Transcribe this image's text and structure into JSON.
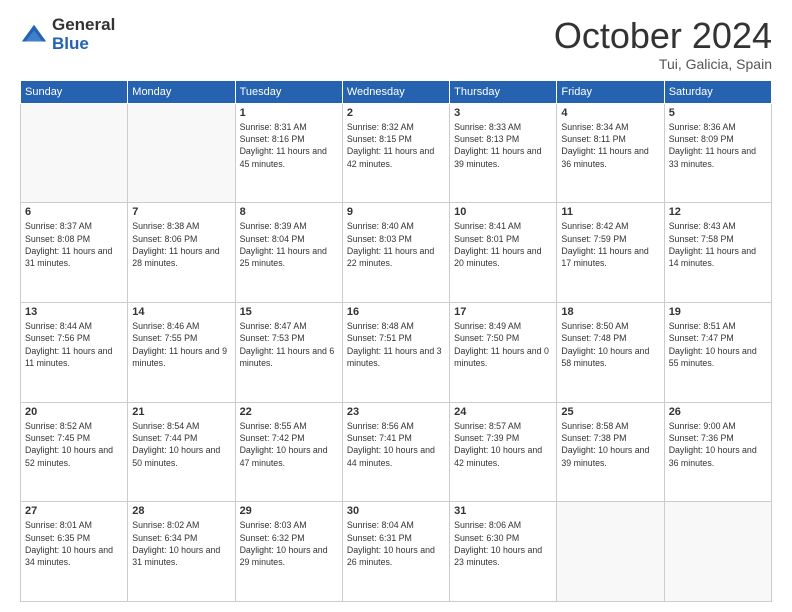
{
  "logo": {
    "general": "General",
    "blue": "Blue"
  },
  "header": {
    "month": "October 2024",
    "location": "Tui, Galicia, Spain"
  },
  "days_of_week": [
    "Sunday",
    "Monday",
    "Tuesday",
    "Wednesday",
    "Thursday",
    "Friday",
    "Saturday"
  ],
  "weeks": [
    [
      {
        "day": "",
        "sunrise": "",
        "sunset": "",
        "daylight": ""
      },
      {
        "day": "",
        "sunrise": "",
        "sunset": "",
        "daylight": ""
      },
      {
        "day": "1",
        "sunrise": "Sunrise: 8:31 AM",
        "sunset": "Sunset: 8:16 PM",
        "daylight": "Daylight: 11 hours and 45 minutes."
      },
      {
        "day": "2",
        "sunrise": "Sunrise: 8:32 AM",
        "sunset": "Sunset: 8:15 PM",
        "daylight": "Daylight: 11 hours and 42 minutes."
      },
      {
        "day": "3",
        "sunrise": "Sunrise: 8:33 AM",
        "sunset": "Sunset: 8:13 PM",
        "daylight": "Daylight: 11 hours and 39 minutes."
      },
      {
        "day": "4",
        "sunrise": "Sunrise: 8:34 AM",
        "sunset": "Sunset: 8:11 PM",
        "daylight": "Daylight: 11 hours and 36 minutes."
      },
      {
        "day": "5",
        "sunrise": "Sunrise: 8:36 AM",
        "sunset": "Sunset: 8:09 PM",
        "daylight": "Daylight: 11 hours and 33 minutes."
      }
    ],
    [
      {
        "day": "6",
        "sunrise": "Sunrise: 8:37 AM",
        "sunset": "Sunset: 8:08 PM",
        "daylight": "Daylight: 11 hours and 31 minutes."
      },
      {
        "day": "7",
        "sunrise": "Sunrise: 8:38 AM",
        "sunset": "Sunset: 8:06 PM",
        "daylight": "Daylight: 11 hours and 28 minutes."
      },
      {
        "day": "8",
        "sunrise": "Sunrise: 8:39 AM",
        "sunset": "Sunset: 8:04 PM",
        "daylight": "Daylight: 11 hours and 25 minutes."
      },
      {
        "day": "9",
        "sunrise": "Sunrise: 8:40 AM",
        "sunset": "Sunset: 8:03 PM",
        "daylight": "Daylight: 11 hours and 22 minutes."
      },
      {
        "day": "10",
        "sunrise": "Sunrise: 8:41 AM",
        "sunset": "Sunset: 8:01 PM",
        "daylight": "Daylight: 11 hours and 20 minutes."
      },
      {
        "day": "11",
        "sunrise": "Sunrise: 8:42 AM",
        "sunset": "Sunset: 7:59 PM",
        "daylight": "Daylight: 11 hours and 17 minutes."
      },
      {
        "day": "12",
        "sunrise": "Sunrise: 8:43 AM",
        "sunset": "Sunset: 7:58 PM",
        "daylight": "Daylight: 11 hours and 14 minutes."
      }
    ],
    [
      {
        "day": "13",
        "sunrise": "Sunrise: 8:44 AM",
        "sunset": "Sunset: 7:56 PM",
        "daylight": "Daylight: 11 hours and 11 minutes."
      },
      {
        "day": "14",
        "sunrise": "Sunrise: 8:46 AM",
        "sunset": "Sunset: 7:55 PM",
        "daylight": "Daylight: 11 hours and 9 minutes."
      },
      {
        "day": "15",
        "sunrise": "Sunrise: 8:47 AM",
        "sunset": "Sunset: 7:53 PM",
        "daylight": "Daylight: 11 hours and 6 minutes."
      },
      {
        "day": "16",
        "sunrise": "Sunrise: 8:48 AM",
        "sunset": "Sunset: 7:51 PM",
        "daylight": "Daylight: 11 hours and 3 minutes."
      },
      {
        "day": "17",
        "sunrise": "Sunrise: 8:49 AM",
        "sunset": "Sunset: 7:50 PM",
        "daylight": "Daylight: 11 hours and 0 minutes."
      },
      {
        "day": "18",
        "sunrise": "Sunrise: 8:50 AM",
        "sunset": "Sunset: 7:48 PM",
        "daylight": "Daylight: 10 hours and 58 minutes."
      },
      {
        "day": "19",
        "sunrise": "Sunrise: 8:51 AM",
        "sunset": "Sunset: 7:47 PM",
        "daylight": "Daylight: 10 hours and 55 minutes."
      }
    ],
    [
      {
        "day": "20",
        "sunrise": "Sunrise: 8:52 AM",
        "sunset": "Sunset: 7:45 PM",
        "daylight": "Daylight: 10 hours and 52 minutes."
      },
      {
        "day": "21",
        "sunrise": "Sunrise: 8:54 AM",
        "sunset": "Sunset: 7:44 PM",
        "daylight": "Daylight: 10 hours and 50 minutes."
      },
      {
        "day": "22",
        "sunrise": "Sunrise: 8:55 AM",
        "sunset": "Sunset: 7:42 PM",
        "daylight": "Daylight: 10 hours and 47 minutes."
      },
      {
        "day": "23",
        "sunrise": "Sunrise: 8:56 AM",
        "sunset": "Sunset: 7:41 PM",
        "daylight": "Daylight: 10 hours and 44 minutes."
      },
      {
        "day": "24",
        "sunrise": "Sunrise: 8:57 AM",
        "sunset": "Sunset: 7:39 PM",
        "daylight": "Daylight: 10 hours and 42 minutes."
      },
      {
        "day": "25",
        "sunrise": "Sunrise: 8:58 AM",
        "sunset": "Sunset: 7:38 PM",
        "daylight": "Daylight: 10 hours and 39 minutes."
      },
      {
        "day": "26",
        "sunrise": "Sunrise: 9:00 AM",
        "sunset": "Sunset: 7:36 PM",
        "daylight": "Daylight: 10 hours and 36 minutes."
      }
    ],
    [
      {
        "day": "27",
        "sunrise": "Sunrise: 8:01 AM",
        "sunset": "Sunset: 6:35 PM",
        "daylight": "Daylight: 10 hours and 34 minutes."
      },
      {
        "day": "28",
        "sunrise": "Sunrise: 8:02 AM",
        "sunset": "Sunset: 6:34 PM",
        "daylight": "Daylight: 10 hours and 31 minutes."
      },
      {
        "day": "29",
        "sunrise": "Sunrise: 8:03 AM",
        "sunset": "Sunset: 6:32 PM",
        "daylight": "Daylight: 10 hours and 29 minutes."
      },
      {
        "day": "30",
        "sunrise": "Sunrise: 8:04 AM",
        "sunset": "Sunset: 6:31 PM",
        "daylight": "Daylight: 10 hours and 26 minutes."
      },
      {
        "day": "31",
        "sunrise": "Sunrise: 8:06 AM",
        "sunset": "Sunset: 6:30 PM",
        "daylight": "Daylight: 10 hours and 23 minutes."
      },
      {
        "day": "",
        "sunrise": "",
        "sunset": "",
        "daylight": ""
      },
      {
        "day": "",
        "sunrise": "",
        "sunset": "",
        "daylight": ""
      }
    ]
  ]
}
